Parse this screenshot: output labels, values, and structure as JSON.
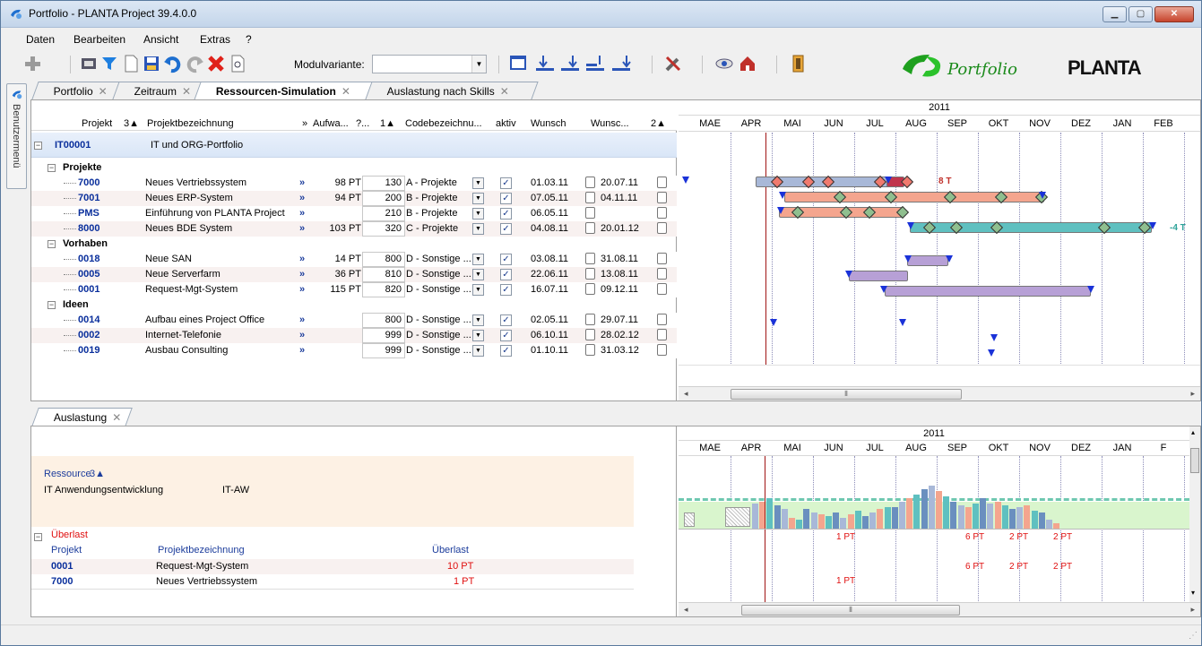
{
  "window": {
    "title": "Portfolio - PLANTA Project 39.4.0.0"
  },
  "menu": [
    "Daten",
    "Bearbeiten",
    "Ansicht",
    "Extras",
    "?"
  ],
  "toolbar": {
    "modulvariante_label": "Modulvariante:",
    "modulvariante_value": ""
  },
  "brand": {
    "portfolio": "Portfolio",
    "planta": "PLANTA"
  },
  "sidetab": {
    "label": "Benutzermenü"
  },
  "tabs": [
    {
      "label": "Portfolio"
    },
    {
      "label": "Zeitraum"
    },
    {
      "label": "Ressourcen-Simulation"
    },
    {
      "label": "Auslastung nach Skills"
    }
  ],
  "grid": {
    "headers": {
      "projekt": "Projekt",
      "projekt_sort": "3▲",
      "bez": "Projektbezeichnung",
      "more": "»",
      "aufwand": "Aufwa...",
      "q": "?...",
      "prio": "1▲",
      "code": "Codebezeichnu...",
      "aktiv": "aktiv",
      "wunsch": "Wunsch",
      "wunsch2": "Wunsc...",
      "sort2": "2▲"
    },
    "root": {
      "id": "IT00001",
      "name": "IT und ORG-Portfolio"
    },
    "groups": [
      {
        "name": "Projekte",
        "rows": [
          {
            "id": "7000",
            "name": "Neues Vertriebssystem",
            "aufwand": "98 PT",
            "prio": "130",
            "code": "A - Projekte",
            "start": "01.03.11",
            "end": "20.07.11"
          },
          {
            "id": "7001",
            "name": "Neues ERP-System",
            "aufwand": "94 PT",
            "prio": "200",
            "code": "B - Projekte",
            "start": "07.05.11",
            "end": "04.11.11"
          },
          {
            "id": "PMS",
            "name": "Einführung von PLANTA Project",
            "aufwand": "",
            "prio": "210",
            "code": "B - Projekte",
            "start": "06.05.11",
            "end": ""
          },
          {
            "id": "8000",
            "name": "Neues BDE System",
            "aufwand": "103 PT",
            "prio": "320",
            "code": "C - Projekte",
            "start": "04.08.11",
            "end": "20.01.12"
          }
        ]
      },
      {
        "name": "Vorhaben",
        "rows": [
          {
            "id": "0018",
            "name": "Neue SAN",
            "aufwand": "14 PT",
            "prio": "800",
            "code": "D - Sonstige ...",
            "start": "03.08.11",
            "end": "31.08.11"
          },
          {
            "id": "0005",
            "name": "Neue Serverfarm",
            "aufwand": "36 PT",
            "prio": "810",
            "code": "D - Sonstige ...",
            "start": "22.06.11",
            "end": "13.08.11"
          },
          {
            "id": "0001",
            "name": "Request-Mgt-System",
            "aufwand": "115 PT",
            "prio": "820",
            "code": "D - Sonstige ...",
            "start": "16.07.11",
            "end": "09.12.11"
          }
        ]
      },
      {
        "name": "Ideen",
        "rows": [
          {
            "id": "0014",
            "name": "Aufbau eines Project Office",
            "aufwand": "",
            "prio": "800",
            "code": "D - Sonstige ...",
            "start": "02.05.11",
            "end": "29.07.11"
          },
          {
            "id": "0002",
            "name": "Internet-Telefonie",
            "aufwand": "",
            "prio": "999",
            "code": "D - Sonstige ...",
            "start": "06.10.11",
            "end": "28.02.12"
          },
          {
            "id": "0019",
            "name": "Ausbau Consulting",
            "aufwand": "",
            "prio": "999",
            "code": "D - Sonstige ...",
            "start": "01.10.11",
            "end": "31.03.12"
          }
        ]
      }
    ]
  },
  "gantt": {
    "year": "2011",
    "months": [
      "MAE",
      "APR",
      "MAI",
      "JUN",
      "JUL",
      "AUG",
      "SEP",
      "OKT",
      "NOV",
      "DEZ",
      "JAN",
      "FEB"
    ],
    "labels": {
      "r7000": "8 T",
      "r8000": "-4 T"
    }
  },
  "bottom": {
    "tab": "Auslastung",
    "year": "2011",
    "months": [
      "MAE",
      "APR",
      "MAI",
      "JUN",
      "JUL",
      "AUG",
      "SEP",
      "OKT",
      "NOV",
      "DEZ",
      "JAN",
      "F"
    ],
    "resource": {
      "header": "Ressource",
      "sort": "3▲",
      "name": "IT Anwendungsentwicklung",
      "code": "IT-AW"
    },
    "overload": {
      "title": "Überlast",
      "col_projekt": "Projekt",
      "col_bez": "Projektbezeichnung",
      "col_ueberlast": "Überlast",
      "rows": [
        {
          "id": "0001",
          "name": "Request-Mgt-System",
          "value": "10 PT"
        },
        {
          "id": "7000",
          "name": "Neues Vertriebssystem",
          "value": "1 PT"
        }
      ]
    },
    "pt_row1": [
      "1 PT",
      "6 PT",
      "2 PT",
      "2 PT"
    ],
    "pt_row2": [
      "6 PT",
      "2 PT",
      "2 PT"
    ],
    "pt_row3": [
      "1 PT"
    ]
  },
  "colors": {
    "accent": "#1c3d9c",
    "overload": "#e01010",
    "bar_blue": "#a8b8d8",
    "bar_salmon": "#f4a58e",
    "bar_teal": "#5fc0c0",
    "bar_purple": "#b7a0d6"
  }
}
